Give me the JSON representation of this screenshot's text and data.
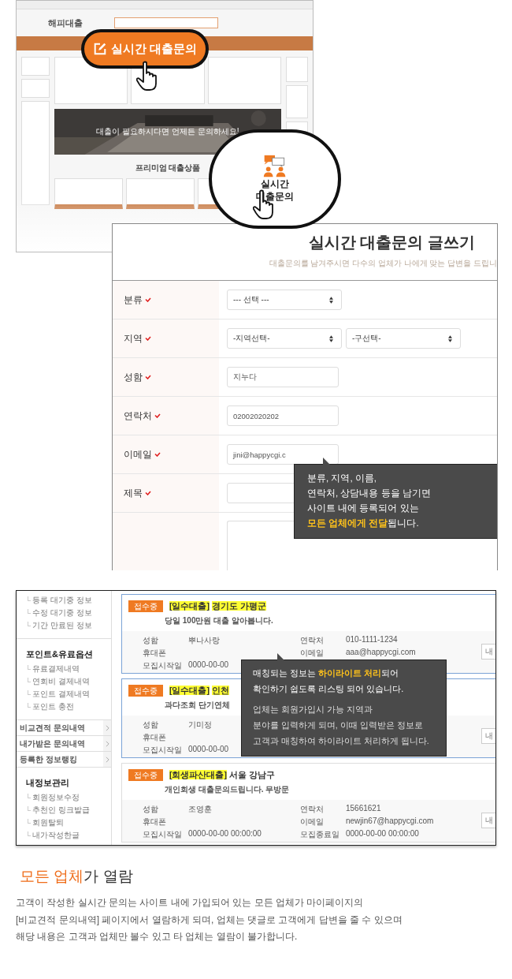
{
  "hero": {
    "logo": "해피대출",
    "banner_text": "대출이 필요하시다면 언제든 문의하세요!",
    "section_title": "프리미엄 대출상품",
    "callout_button": "실시간 대출문의",
    "callout_card": [
      "실시간",
      "대출문의"
    ]
  },
  "form": {
    "title": "실시간 대출문의 글쓰기",
    "subtitle": "대출문의를 남겨주시면 다수의 업체가 나에게 맞는 답변을 드립니",
    "rows": [
      {
        "label": "분류",
        "kind": "select",
        "options": [
          "--- 선택 ---"
        ]
      },
      {
        "label": "지역",
        "kind": "select",
        "options": [
          "-지역선택-",
          "-구선택-"
        ]
      },
      {
        "label": "성함",
        "kind": "input",
        "value": "지누다"
      },
      {
        "label": "연락처",
        "kind": "input",
        "value": "02002020202"
      },
      {
        "label": "이메일",
        "kind": "input",
        "value": "jini@happycgi.c"
      },
      {
        "label": "제목",
        "kind": "wide"
      },
      {
        "kind": "textarea"
      }
    ],
    "tooltip": [
      "분류, 지역, 이름,",
      "연락처, 상담내용 등을 남기면",
      "사이트 내에 등록되어 있는",
      "**모든 업체에게 전달**됩니다."
    ]
  },
  "listing": {
    "sidebar": [
      {
        "kind": "links",
        "items": [
          "등록 대기중 정보",
          "수정 대기중 정보",
          "기간 만료된 정보"
        ]
      },
      {
        "kind": "links",
        "title": "포인트&유료옵션",
        "items": [
          "유료결제내역",
          "연회비 결제내역",
          "포인트 결제내역",
          "포인트 충전"
        ]
      },
      {
        "kind": "menu",
        "items": [
          "비교견적 문의내역",
          "내가받은 문의내역",
          "등록한 정보랭킹"
        ]
      },
      {
        "kind": "links",
        "title": "내정보관리",
        "items": [
          "회원정보수정",
          "추천인 링크발급",
          "회원탈퇴",
          "내가작성한글"
        ]
      }
    ],
    "cards": [
      {
        "status": "접수중",
        "category": "[일수대출]",
        "region": "경기도 가평군",
        "region_highlighted": true,
        "matched": true,
        "description": "당일 100만원 대출 알아봅니다.",
        "left": [
          {
            "label": "성함",
            "value": "뿌나사랑"
          },
          {
            "label": "휴대폰"
          },
          {
            "label": "모집시작일",
            "value": "0000-00-00"
          }
        ],
        "right": [
          {
            "label": "연락처",
            "value": "010-1111-1234"
          },
          {
            "label": "이메일",
            "value": "aaa@happycgi.com"
          }
        ],
        "button": "내"
      },
      {
        "status": "접수중",
        "category": "[일수대출]",
        "region": "인천",
        "region_highlighted": true,
        "matched": true,
        "description": "과다조회 단기연체",
        "left": [
          {
            "label": "성함",
            "value": "기미정"
          },
          {
            "label": "휴대폰"
          },
          {
            "label": "모집시작일",
            "value": "0000-00-00"
          }
        ],
        "button": "내"
      },
      {
        "status": "접수중",
        "category": "[회생파산대출]",
        "region": "서울 강남구",
        "region_highlighted": false,
        "matched": false,
        "description": "개인회생 대출문의드립니다. 무방문",
        "left": [
          {
            "label": "성함",
            "value": "조영훈"
          },
          {
            "label": "휴대폰"
          },
          {
            "label": "모집시작일",
            "value": "0000-00-00 00:00:00"
          }
        ],
        "right": [
          {
            "label": "연락처",
            "value": "15661621"
          },
          {
            "label": "이메일",
            "value": "newjin67@happycgi.com"
          },
          {
            "label": "모집종료일",
            "value": "0000-00-00 00:00:00"
          }
        ],
        "button": "내"
      }
    ],
    "tooltip": {
      "lines": [
        "매칭되는 정보는 **하이라이트 처리**되어",
        "확인하기 쉽도록 리스팅 되어 있습니다."
      ],
      "detail": [
        "업체는 회원가입시 가능 지역과",
        "분야를 입력하게 되며, 이때 입력받은 정보로",
        "고객과 매칭하여 하이라이트 처리하게 됩니다."
      ]
    }
  },
  "footer": {
    "heading": "**모든 업체**가 열람",
    "paragraph": [
      "고객이 작성한 실시간 문의는 사이트 내에 가입되어 있는 모든 업체가 마이페이지의",
      "[비교견적 문의내역] 페이지에서 열람하게 되며, 업체는 댓글로 고객에게 답변을 줄 수 있으며",
      "해당 내용은 고객과 업체만 볼수 있고 타 업체는 열람이 불가합니다."
    ]
  }
}
